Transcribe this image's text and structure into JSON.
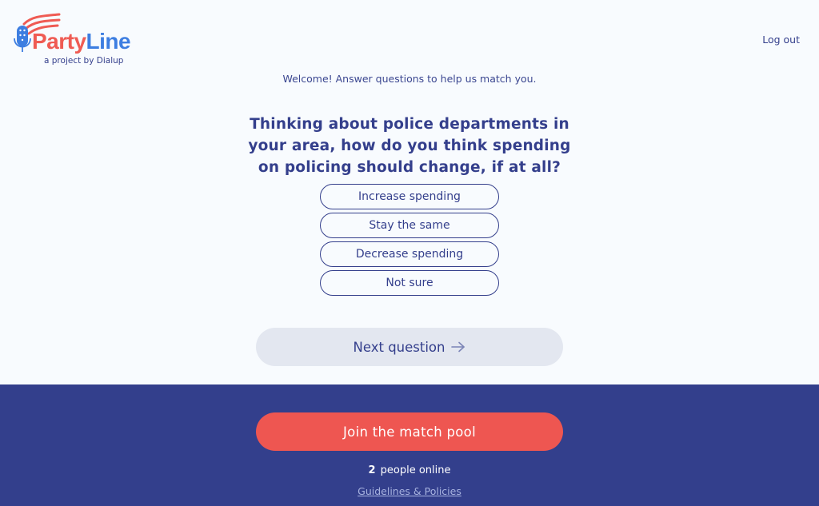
{
  "header": {
    "logo": {
      "word_part1": "Party",
      "word_part2": "Line",
      "tagline": "a project by Dialup"
    },
    "logout_label": "Log out"
  },
  "main": {
    "welcome": "Welcome! Answer questions to help us match you.",
    "question": "Thinking about police departments in your area, how do you think spending on policing should change, if at all?",
    "options": [
      {
        "label": "Increase spending"
      },
      {
        "label": "Stay the same"
      },
      {
        "label": "Decrease spending"
      },
      {
        "label": "Not sure"
      }
    ],
    "next_button": {
      "label": "Next question",
      "icon": "arrow-right-icon"
    }
  },
  "footer": {
    "join_button": "Join the match pool",
    "online_count": "2",
    "online_text": "people online",
    "guidelines_link": "Guidelines & Policies"
  },
  "colors": {
    "navy": "#343f8c",
    "brand_red": "#ef5b53",
    "brand_blue": "#3d7ee1",
    "join_red": "#ee5651",
    "footer_bg": "#333f8c",
    "next_bg": "#e3e7f0",
    "page_bg": "#f8fbfe"
  }
}
